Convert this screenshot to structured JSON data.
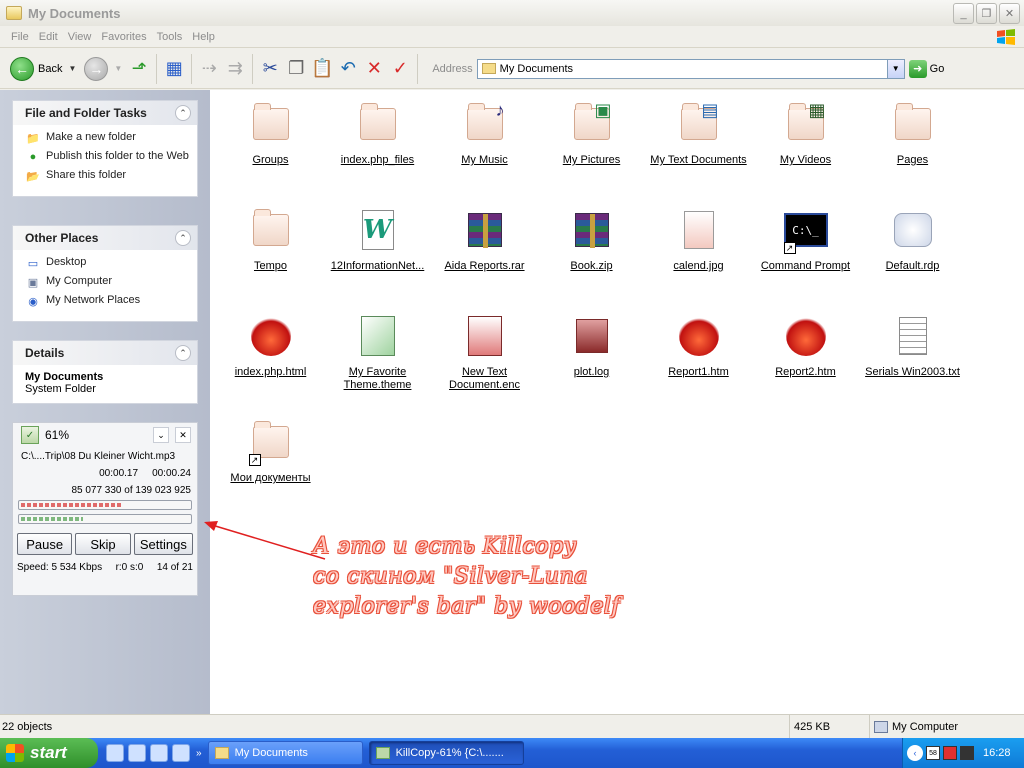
{
  "window": {
    "title": "My Documents"
  },
  "menu": [
    "File",
    "Edit",
    "View",
    "Favorites",
    "Tools",
    "Help"
  ],
  "toolbar": {
    "back_label": "Back",
    "address_label": "Address",
    "address_value": "My Documents",
    "go_label": "Go"
  },
  "panels": {
    "file_tasks": {
      "title": "File and Folder Tasks",
      "items": [
        {
          "label": "Make a new folder",
          "icon": "new-folder-icon"
        },
        {
          "label": "Publish this folder to the Web",
          "icon": "publish-web-icon"
        },
        {
          "label": "Share this folder",
          "icon": "share-folder-icon"
        }
      ]
    },
    "other_places": {
      "title": "Other Places",
      "items": [
        {
          "label": "Desktop",
          "icon": "desktop-icon"
        },
        {
          "label": "My Computer",
          "icon": "my-computer-icon"
        },
        {
          "label": "My Network Places",
          "icon": "network-places-icon"
        }
      ]
    },
    "details": {
      "title": "Details",
      "name": "My Documents",
      "type": "System Folder"
    }
  },
  "killcopy": {
    "percent": "61%",
    "progress": 0.61,
    "file": "C:\\....Trip\\08 Du Kleiner Wicht.mp3",
    "elapsed": "00:00.17",
    "remaining": "00:00.24",
    "bytes": "85 077 330 of 139 023 925",
    "buttons": {
      "pause": "Pause",
      "skip": "Skip",
      "settings": "Settings"
    },
    "speed": "Speed: 5 534 Kbps",
    "rs": "r:0 s:0",
    "count": "14 of 21"
  },
  "files": [
    {
      "name": "Groups",
      "icon": "folder-icon"
    },
    {
      "name": "index.php_files",
      "icon": "folder-icon"
    },
    {
      "name": "My Music",
      "icon": "music-folder-icon"
    },
    {
      "name": "My Pictures",
      "icon": "pictures-folder-icon"
    },
    {
      "name": "My Text Documents",
      "icon": "text-folder-icon"
    },
    {
      "name": "My Videos",
      "icon": "video-folder-icon"
    },
    {
      "name": "Pages",
      "icon": "folder-icon"
    },
    {
      "name": "Tempo",
      "icon": "folder-icon"
    },
    {
      "name": "12InformationNet...",
      "icon": "word-document-icon"
    },
    {
      "name": "Aida Reports.rar",
      "icon": "rar-archive-icon"
    },
    {
      "name": "Book.zip",
      "icon": "zip-archive-icon"
    },
    {
      "name": "calend.jpg",
      "icon": "image-file-icon"
    },
    {
      "name": "Command Prompt",
      "icon": "command-prompt-icon"
    },
    {
      "name": "Default.rdp",
      "icon": "remote-desktop-icon"
    },
    {
      "name": "index.php.html",
      "icon": "html-file-icon"
    },
    {
      "name": "My Favorite Theme.theme",
      "icon": "theme-file-icon"
    },
    {
      "name": "New Text Document.enc",
      "icon": "encrypted-file-icon"
    },
    {
      "name": "plot.log",
      "icon": "log-file-icon"
    },
    {
      "name": "Report1.htm",
      "icon": "html-file-icon"
    },
    {
      "name": "Report2.htm",
      "icon": "html-file-icon"
    },
    {
      "name": "Serials Win2003.txt",
      "icon": "text-file-icon"
    },
    {
      "name": "Мои документы",
      "icon": "shortcut-folder-icon"
    }
  ],
  "annotation": [
    "А это и есть  Killcopy",
    "со скином \"Silver-Luna",
    "explorer's bar\" by woodelf"
  ],
  "status": {
    "objects": "22 objects",
    "size": "425 KB",
    "zone": "My Computer"
  },
  "taskbar": {
    "start": "start",
    "tasks": [
      {
        "label": "My Documents"
      },
      {
        "label": "KillCopy-61% {C:\\......."
      }
    ],
    "tray_lang": "58",
    "time": "16:28"
  },
  "colors": {
    "accent_green": "#2a9a2a",
    "left_pane": "#b5bccc",
    "annotation": "#e8503a",
    "taskbar_blue": "#235fd6"
  }
}
